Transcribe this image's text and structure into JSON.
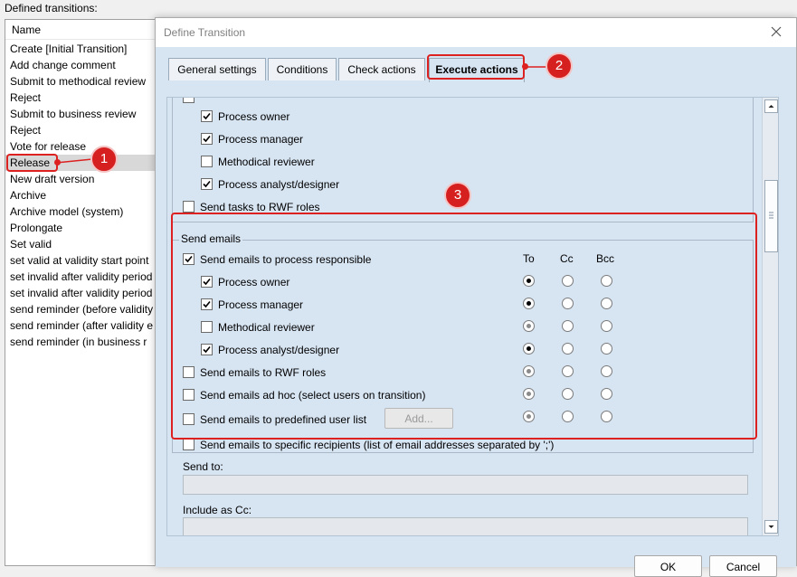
{
  "background": {
    "title": "Defined transitions:",
    "column_header": "Name",
    "rows": [
      "Create [Initial Transition]",
      "Add change comment",
      "Submit to methodical review",
      "Reject",
      "Submit to business review",
      "Reject",
      "Vote for release",
      "Release",
      "New draft version",
      "Archive",
      "Archive model (system)",
      "Prolongate",
      "Set valid",
      "set valid at validity start point",
      "set invalid after validity period",
      "set invalid after validity period",
      "send reminder (before validity",
      "send reminder (after validity e",
      "send reminder (in business r"
    ],
    "selected_row": "Release"
  },
  "dialog": {
    "title": "Define Transition",
    "close_icon": "close-icon",
    "tabs": [
      {
        "label": "General settings"
      },
      {
        "label": "Conditions"
      },
      {
        "label": "Check actions"
      },
      {
        "label": "Execute actions"
      }
    ],
    "active_tab": "Execute actions",
    "tasks_section": {
      "items": [
        {
          "label": "Process owner",
          "checked": true
        },
        {
          "label": "Process manager",
          "checked": true
        },
        {
          "label": "Methodical reviewer",
          "checked": false
        },
        {
          "label": "Process analyst/designer",
          "checked": true
        }
      ],
      "rwf_label": "Send tasks to RWF roles",
      "rwf_checked": false
    },
    "send_emails": {
      "group_label": "Send emails",
      "columns": {
        "to": "To",
        "cc": "Cc",
        "bcc": "Bcc"
      },
      "process_responsible": {
        "label": "Send emails to process responsible",
        "checked": true
      },
      "role_items": [
        {
          "label": "Process owner",
          "checked": true,
          "recipient": "To"
        },
        {
          "label": "Process manager",
          "checked": true,
          "recipient": "To"
        },
        {
          "label": "Methodical reviewer",
          "checked": false,
          "recipient": "To"
        },
        {
          "label": "Process analyst/designer",
          "checked": true,
          "recipient": "To"
        }
      ],
      "rwf_roles": {
        "label": "Send emails to RWF roles",
        "checked": false,
        "recipient": "To"
      },
      "ad_hoc": {
        "label": "Send emails ad hoc (select users on transition)",
        "checked": false,
        "recipient": "To"
      },
      "predefined": {
        "label": "Send emails to predefined user list",
        "checked": false,
        "recipient": "To"
      },
      "add_button": "Add...",
      "specific": {
        "label": "Send emails to specific recipients (list of email addresses separated by ';')",
        "checked": false
      }
    },
    "send_to_label": "Send to:",
    "send_to_value": "",
    "include_cc_label": "Include as Cc:",
    "include_cc_value": "",
    "ok_label": "OK",
    "cancel_label": "Cancel"
  },
  "annotations": {
    "badge1": "1",
    "badge2": "2",
    "badge3": "3",
    "color": "#dd2020"
  }
}
